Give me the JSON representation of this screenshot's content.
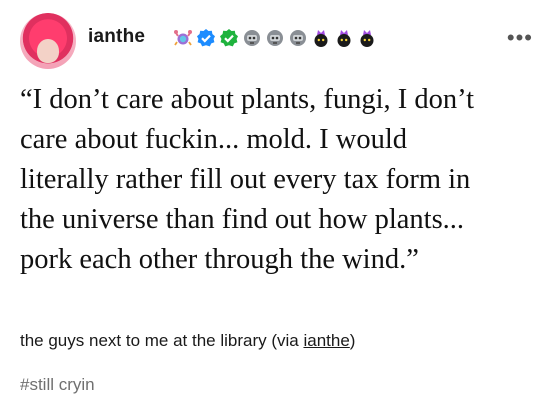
{
  "post": {
    "username": "ianthe",
    "badges": [
      "crab-badge-icon",
      "blue-check-icon",
      "green-check-icon",
      "robot-head-icon",
      "robot-head-icon",
      "robot-head-icon",
      "purple-crown-bomb-icon",
      "purple-crown-bomb-icon",
      "purple-crown-bomb-icon"
    ],
    "more_label": "•••",
    "quote_lines": [
      "“I don’t care about plants, fungi, I don’t",
      "care about fuckin... mold. I would",
      "literally rather fill out every tax form in",
      "the universe than find out how plants...",
      "pork each other through the wind.”"
    ],
    "caption_prefix": "the guys next to me at the library (via ",
    "caption_link": "ianthe",
    "caption_suffix": ")",
    "tag": "#still cryin"
  }
}
